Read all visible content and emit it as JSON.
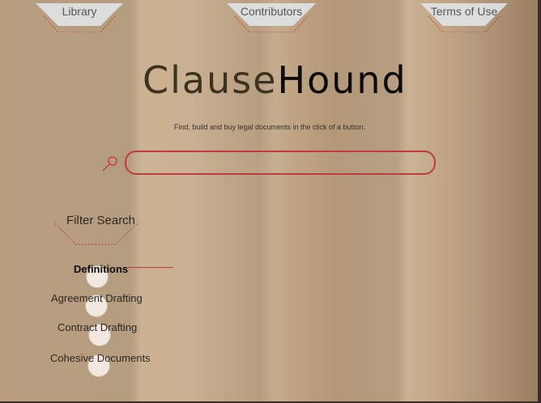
{
  "nav": {
    "tabs": [
      {
        "label": "Library"
      },
      {
        "label": "Contributors"
      },
      {
        "label": "Terms of Use"
      }
    ]
  },
  "brand": {
    "logo_part1": "Clause",
    "logo_part2": "Hound",
    "tagline": "Find, build and buy legal documents in the click of a button."
  },
  "search": {
    "value": "",
    "placeholder": ""
  },
  "filter": {
    "title": "Filter Search",
    "items": [
      {
        "label": "Definitions",
        "active": true
      },
      {
        "label": "Agreement Drafting",
        "active": false
      },
      {
        "label": "Contract Drafting",
        "active": false
      },
      {
        "label": "Cohesive Documents",
        "active": false
      }
    ]
  },
  "colors": {
    "accent": "#c03a40",
    "tab_fill": "#dfe3e6",
    "text_dark": "#2e2822"
  },
  "icons": {
    "search": "search-icon"
  }
}
